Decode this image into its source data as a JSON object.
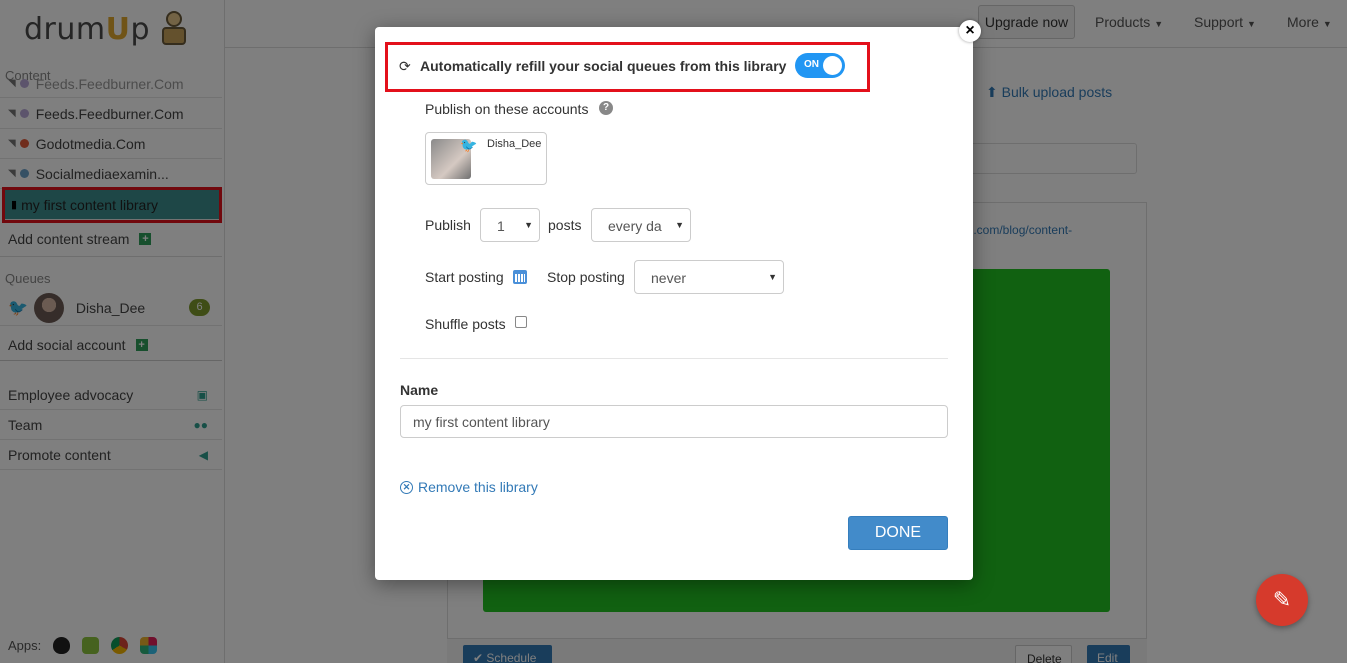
{
  "brand": {
    "logo_prefix": "drum",
    "logo_u": "U",
    "logo_suffix": "p"
  },
  "sidebar": {
    "content_label": "Content",
    "streams": [
      {
        "label": "Feeds.Feedburner.Com",
        "dot_color": "#b9a9d8"
      },
      {
        "label": "Feeds.Feedburner.Com",
        "dot_color": "#b9a9d8"
      },
      {
        "label": "Godotmedia.Com",
        "dot_color": "#e05a3a"
      },
      {
        "label": "Socialmediaexamin...",
        "dot_color": "#6aa0c8"
      }
    ],
    "active_library": "my first content library",
    "add_content_stream": "Add content stream",
    "queues_label": "Queues",
    "queue_account": {
      "name": "Disha_Dee",
      "count": "6"
    },
    "add_social_account": "Add social account",
    "extras": [
      "Employee advocacy",
      "Team",
      "Promote content"
    ],
    "apps_label": "Apps:"
  },
  "topbar": {
    "upgrade": "Upgrade now",
    "nav": [
      "Products",
      "Support",
      "More"
    ]
  },
  "main": {
    "bulk_upload": "Bulk upload posts",
    "link_fragment": "ge.com/blog/content-",
    "schedule": "Schedule",
    "delete": "Delete",
    "edit": "Edit"
  },
  "modal": {
    "close": "×",
    "refill_text": "Automatically refill your social queues from this library",
    "toggle_label": "ON",
    "publish_on_accounts": "Publish on these accounts",
    "account_name": "Disha_Dee",
    "publish_label": "Publish",
    "publish_count": "1",
    "posts_label": "posts",
    "frequency": "every da",
    "start_posting": "Start posting",
    "stop_posting": "Stop posting",
    "stop_value": "never",
    "shuffle_posts": "Shuffle posts",
    "name_label": "Name",
    "name_value": "my first content library",
    "remove_library": "Remove this library",
    "done": "DONE"
  },
  "colors": {
    "accent": "#337ab7",
    "toggle": "#2196f3",
    "highlight": "#e3101b",
    "active_item": "#3d8f8f",
    "green_image": "#22c222"
  }
}
